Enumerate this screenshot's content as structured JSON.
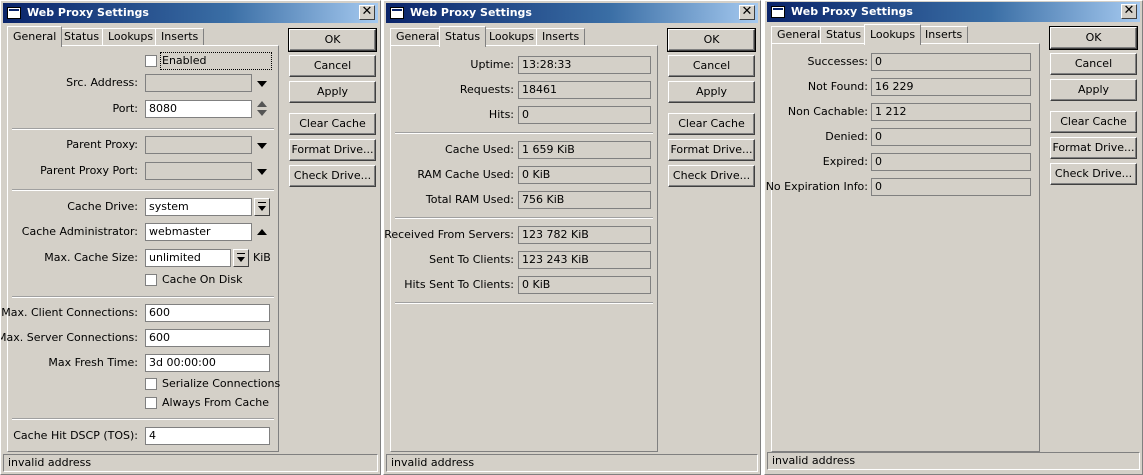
{
  "window_title": "Web Proxy Settings",
  "close_glyph": "✕",
  "tabs": [
    "General",
    "Status",
    "Lookups",
    "Inserts"
  ],
  "buttons": {
    "ok": "OK",
    "cancel": "Cancel",
    "apply": "Apply",
    "clear_cache": "Clear Cache",
    "format_drive": "Format Drive...",
    "check_drive": "Check Drive..."
  },
  "status_text": "invalid address",
  "general": {
    "enabled_label": "Enabled",
    "enabled_checked": false,
    "src_address_label": "Src. Address:",
    "src_address_value": "",
    "port_label": "Port:",
    "port_value": "8080",
    "parent_proxy_label": "Parent Proxy:",
    "parent_proxy_value": "",
    "parent_proxy_port_label": "Parent Proxy Port:",
    "parent_proxy_port_value": "",
    "cache_drive_label": "Cache Drive:",
    "cache_drive_value": "system",
    "cache_admin_label": "Cache Administrator:",
    "cache_admin_value": "webmaster",
    "max_cache_size_label": "Max. Cache Size:",
    "max_cache_size_value": "unlimited",
    "max_cache_size_unit": "KiB",
    "cache_on_disk_label": "Cache On Disk",
    "max_client_conn_label": "Max. Client Connections:",
    "max_client_conn_value": "600",
    "max_server_conn_label": "Max. Server Connections:",
    "max_server_conn_value": "600",
    "max_fresh_time_label": "Max Fresh Time:",
    "max_fresh_time_value": "3d 00:00:00",
    "serialize_conn_label": "Serialize Connections",
    "always_from_cache_label": "Always From Cache",
    "cache_hit_dscp_label": "Cache Hit DSCP (TOS):",
    "cache_hit_dscp_value": "4"
  },
  "status": {
    "uptime_label": "Uptime:",
    "uptime_value": "13:28:33",
    "requests_label": "Requests:",
    "requests_value": "18461",
    "hits_label": "Hits:",
    "hits_value": "0",
    "cache_used_label": "Cache Used:",
    "cache_used_value": "1 659 KiB",
    "ram_cache_used_label": "RAM Cache Used:",
    "ram_cache_used_value": "0 KiB",
    "total_ram_used_label": "Total RAM Used:",
    "total_ram_used_value": "756 KiB",
    "received_from_servers_label": "Received From Servers:",
    "received_from_servers_value": "123 782 KiB",
    "sent_to_clients_label": "Sent To Clients:",
    "sent_to_clients_value": "123 243 KiB",
    "hits_sent_to_clients_label": "Hits Sent To Clients:",
    "hits_sent_to_clients_value": "0 KiB"
  },
  "lookups": {
    "successes_label": "Successes:",
    "successes_value": "0",
    "not_found_label": "Not Found:",
    "not_found_value": "16 229",
    "non_cachable_label": "Non Cachable:",
    "non_cachable_value": "1 212",
    "denied_label": "Denied:",
    "denied_value": "0",
    "expired_label": "Expired:",
    "expired_value": "0",
    "no_expiration_label": "No Expiration Info:",
    "no_expiration_value": "0"
  }
}
